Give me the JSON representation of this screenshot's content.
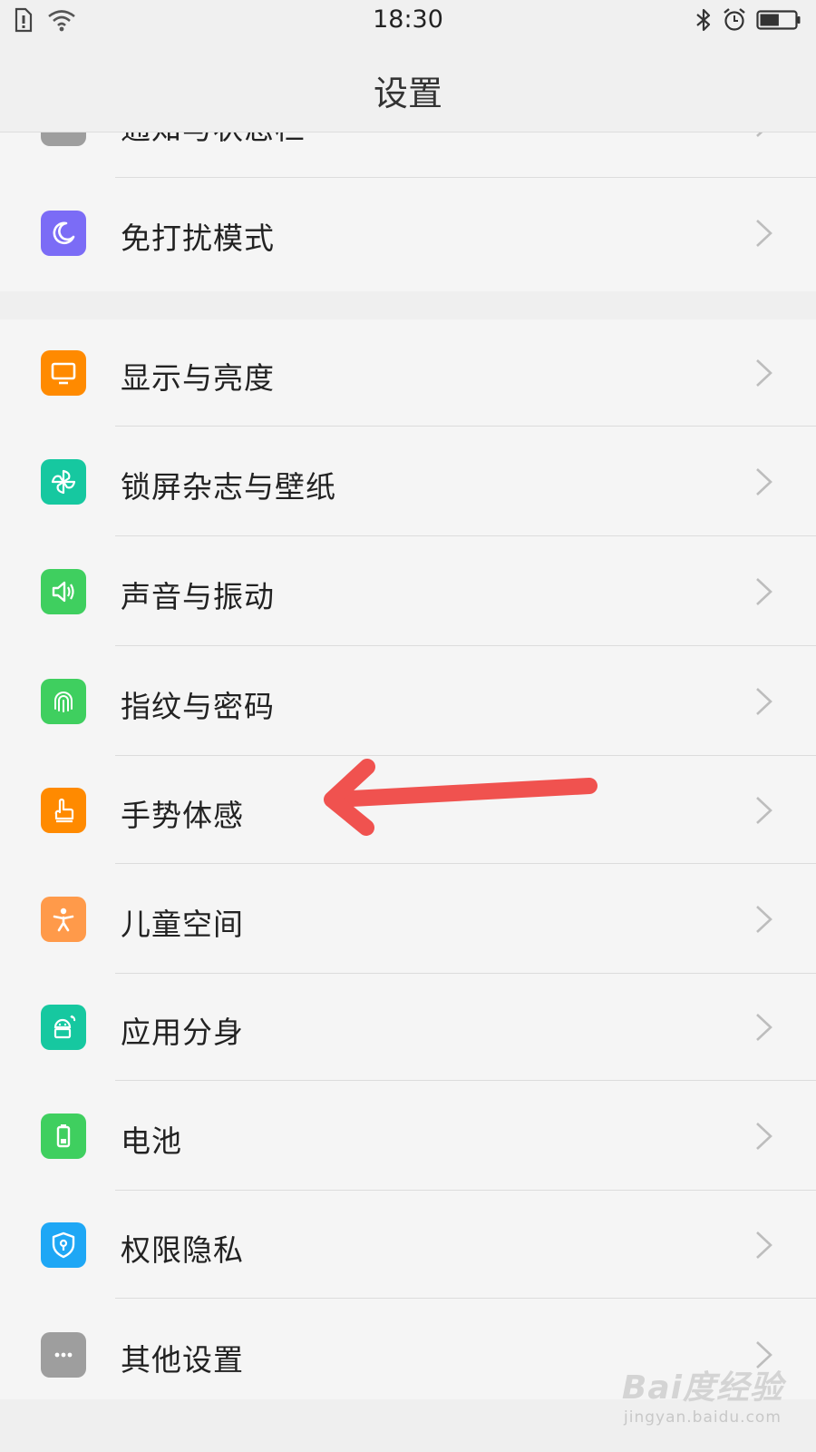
{
  "status_bar": {
    "time": "18:30",
    "left_icons": [
      "sim-alert-icon",
      "wifi-icon"
    ],
    "right_icons": [
      "bluetooth-icon",
      "alarm-clock-icon",
      "battery-icon"
    ],
    "battery_level": 0.55
  },
  "header": {
    "title": "设置"
  },
  "top_group": {
    "items": [
      {
        "label": "通知与状态栏",
        "icon": "notification-icon",
        "color": "#9e9e9e"
      },
      {
        "label": "免打扰模式",
        "icon": "moon-icon",
        "color": "#7b6cf6"
      }
    ]
  },
  "main_group": {
    "items": [
      {
        "label": "显示与亮度",
        "icon": "monitor-icon",
        "color": "#ff8a00"
      },
      {
        "label": "锁屏杂志与壁纸",
        "icon": "pinwheel-icon",
        "color": "#16c8a0"
      },
      {
        "label": "声音与振动",
        "icon": "speaker-icon",
        "color": "#3fcf5f"
      },
      {
        "label": "指纹与密码",
        "icon": "fingerprint-icon",
        "color": "#3fcf5f"
      },
      {
        "label": "手势体感",
        "icon": "hand-pointer-icon",
        "color": "#ff8a00"
      },
      {
        "label": "儿童空间",
        "icon": "child-icon",
        "color": "#ff9a4a"
      },
      {
        "label": "应用分身",
        "icon": "android-clone-icon",
        "color": "#16c8a0"
      },
      {
        "label": "电池",
        "icon": "battery-app-icon",
        "color": "#3fcf5f"
      },
      {
        "label": "权限隐私",
        "icon": "shield-icon",
        "color": "#1ea7f5"
      },
      {
        "label": "其他设置",
        "icon": "more-dots-icon",
        "color": "#9e9e9e"
      }
    ]
  },
  "annotation": {
    "color": "#f0524f",
    "points_to": "手势体感"
  },
  "watermark": {
    "logo": "Bai度经验",
    "url": "jingyan.baidu.com"
  }
}
